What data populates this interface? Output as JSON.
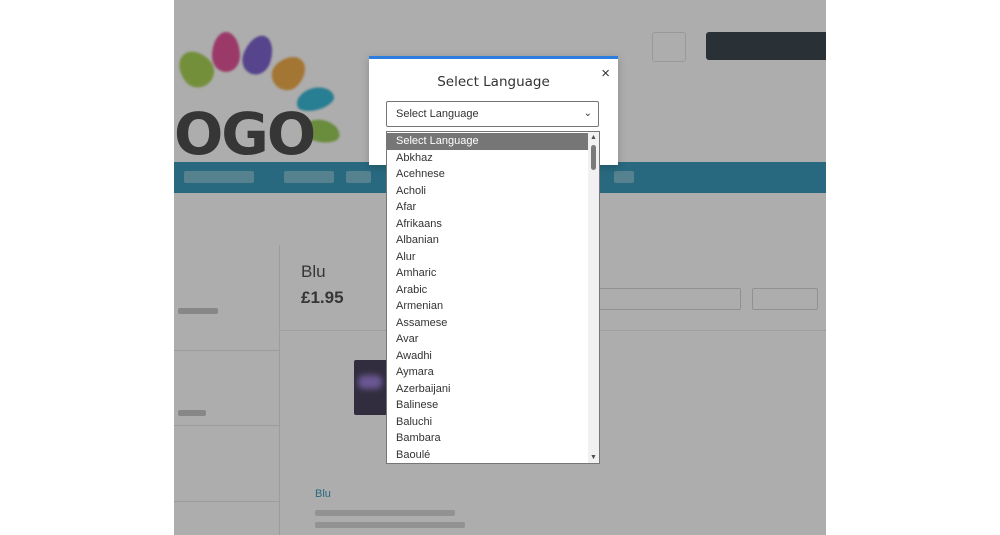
{
  "background_page": {
    "logo_text": "OGO",
    "product_title": "Blu",
    "product_price": "£1.95",
    "link_text": "Blu"
  },
  "modal": {
    "title": "Select Language",
    "close_glyph": "×",
    "select": {
      "value": "Select Language",
      "chevron_glyph": "⌄"
    }
  },
  "dropdown": {
    "selected_index": 0,
    "options": [
      "Select Language",
      "Abkhaz",
      "Acehnese",
      "Acholi",
      "Afar",
      "Afrikaans",
      "Albanian",
      "Alur",
      "Amharic",
      "Arabic",
      "Armenian",
      "Assamese",
      "Avar",
      "Awadhi",
      "Aymara",
      "Azerbaijani",
      "Balinese",
      "Baluchi",
      "Bambara",
      "Baoulé"
    ],
    "scroll_up_glyph": "▲",
    "scroll_down_glyph": "▼"
  },
  "colors": {
    "accent": "#2b7de0",
    "nav": "#1a8ab0",
    "selected_option": "#767676"
  }
}
